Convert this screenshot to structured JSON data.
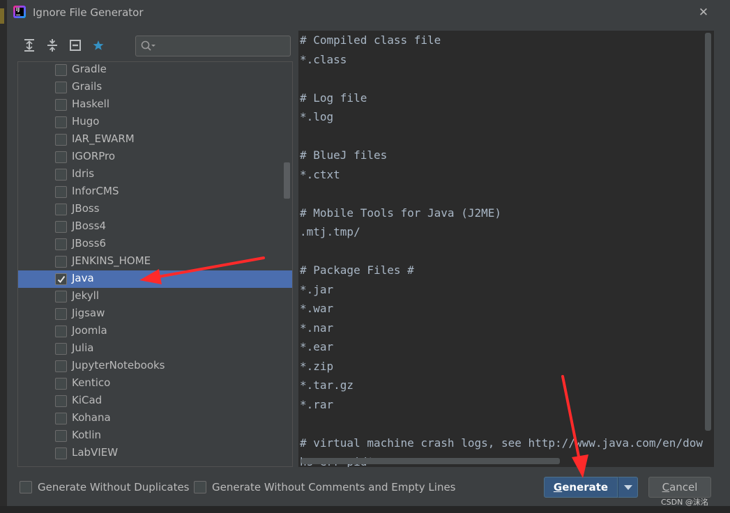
{
  "window": {
    "title": "Ignore File Generator"
  },
  "toolbar": {
    "icons": [
      "expand-all-icon",
      "collapse-all-icon",
      "toggle-section-icon",
      "star-icon"
    ],
    "search": {
      "value": "",
      "placeholder": ""
    }
  },
  "tree": {
    "items": [
      {
        "label": "Gradle",
        "checked": false
      },
      {
        "label": "Grails",
        "checked": false
      },
      {
        "label": "Haskell",
        "checked": false
      },
      {
        "label": "Hugo",
        "checked": false
      },
      {
        "label": "IAR_EWARM",
        "checked": false
      },
      {
        "label": "IGORPro",
        "checked": false
      },
      {
        "label": "Idris",
        "checked": false
      },
      {
        "label": "InforCMS",
        "checked": false
      },
      {
        "label": "JBoss",
        "checked": false
      },
      {
        "label": "JBoss4",
        "checked": false
      },
      {
        "label": "JBoss6",
        "checked": false
      },
      {
        "label": "JENKINS_HOME",
        "checked": false
      },
      {
        "label": "Java",
        "checked": true,
        "selected": true
      },
      {
        "label": "Jekyll",
        "checked": false
      },
      {
        "label": "Jigsaw",
        "checked": false
      },
      {
        "label": "Joomla",
        "checked": false
      },
      {
        "label": "Julia",
        "checked": false
      },
      {
        "label": "JupyterNotebooks",
        "checked": false
      },
      {
        "label": "Kentico",
        "checked": false
      },
      {
        "label": "KiCad",
        "checked": false
      },
      {
        "label": "Kohana",
        "checked": false
      },
      {
        "label": "Kotlin",
        "checked": false
      },
      {
        "label": "LabVIEW",
        "checked": false
      }
    ]
  },
  "preview": {
    "lines": [
      "# Compiled class file",
      "*.class",
      "",
      "# Log file",
      "*.log",
      "",
      "# BlueJ files",
      "*.ctxt",
      "",
      "# Mobile Tools for Java (J2ME)",
      ".mtj.tmp/",
      "",
      "# Package Files #",
      "*.jar",
      "*.war",
      "*.nar",
      "*.ear",
      "*.zip",
      "*.tar.gz",
      "*.rar",
      "",
      "# virtual machine crash logs, see http://www.java.com/en/dow",
      "hs_err_pid*"
    ]
  },
  "footer": {
    "option1": "Generate Without Duplicates",
    "option2": "Generate Without Comments and Empty Lines",
    "generate_mnemonic": "G",
    "generate_rest": "enerate",
    "cancel_mnemonic": "C",
    "cancel_rest": "ancel"
  },
  "watermark": "CSDN @沫洺",
  "colors": {
    "selection": "#4b6eaf",
    "primary_button": "#365880",
    "annotation_arrow": "#ff2a2a"
  }
}
